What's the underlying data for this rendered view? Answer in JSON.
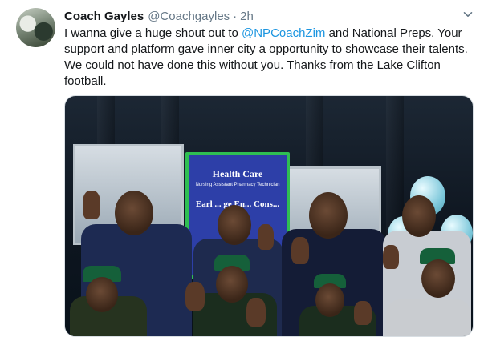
{
  "tweet": {
    "author_name": "Coach Gayles",
    "author_handle": "@Coachgayles",
    "separator": "·",
    "time": "2h",
    "text_part1": "I wanna give a huge shout out to ",
    "mention": "@NPCoachZim",
    "text_part2": " and National Preps. Your support and platform gave inner city a opportunity to showcase their talents. We could not have done this without you. Thanks from the Lake Clifton football."
  },
  "media": {
    "banner_title": "Health Care",
    "banner_subtitle": "Nursing Assistant Pharmacy Technician",
    "banner_lower": "Earl ... ge En... Cons..."
  },
  "colors": {
    "link": "#1b95e0",
    "muted": "#657786",
    "banner_blue": "#2d3fa8",
    "banner_green": "#2fbf52"
  },
  "icons": [
    "avatar",
    "chevron-down-icon"
  ]
}
